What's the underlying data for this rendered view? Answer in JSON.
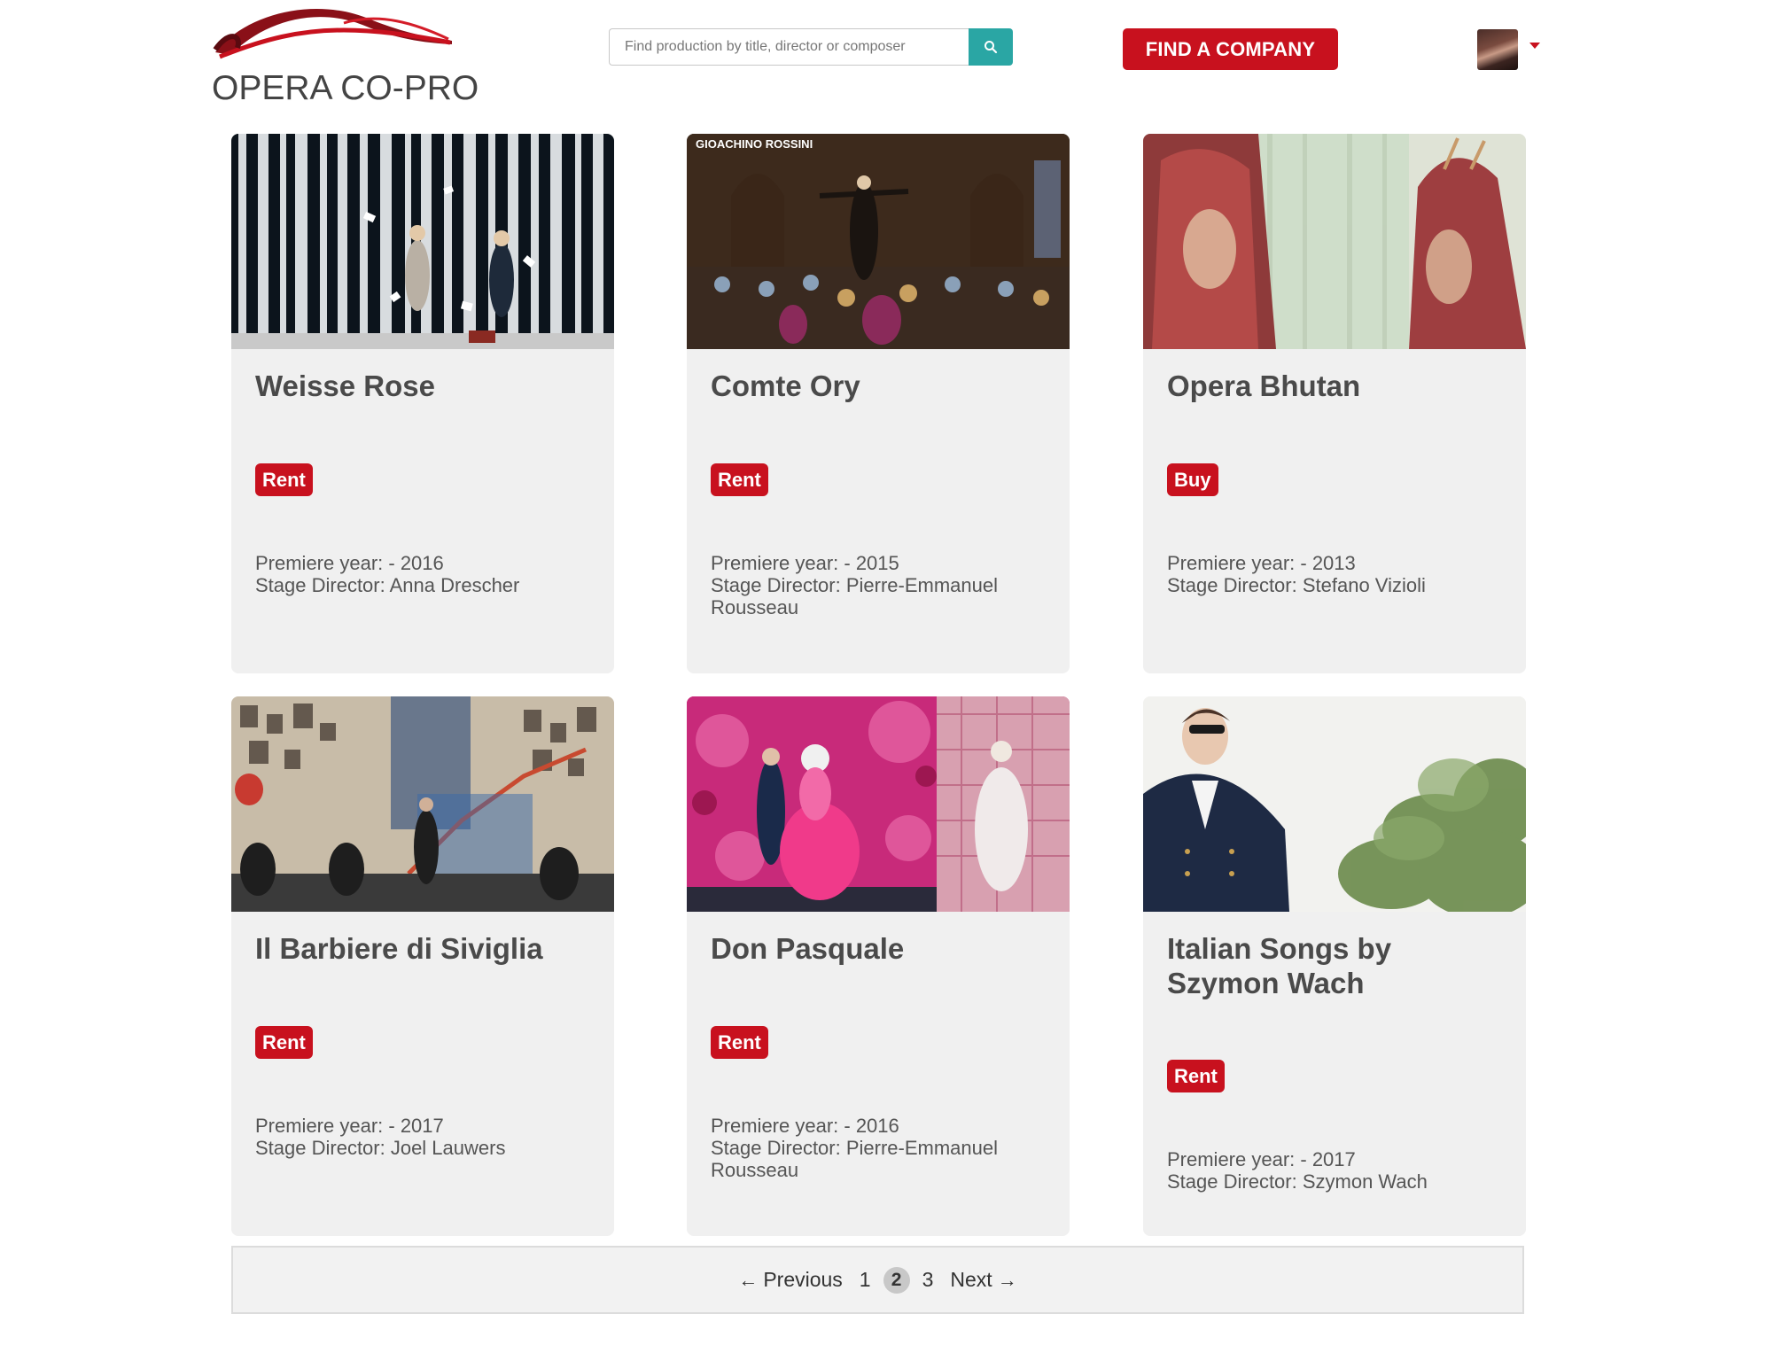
{
  "header": {
    "logo_text": "OPERA CO-PRO",
    "search_placeholder": "Find production by title, director or composer",
    "find_company_label": "FIND A COMPANY"
  },
  "colors": {
    "brand_red": "#c8111e",
    "search_teal": "#2aa6a4",
    "card_bg": "#f0f0f0"
  },
  "productions": [
    {
      "title": "Weisse Rose",
      "badge": "Rent",
      "premiere": "Premiere year: - 2016",
      "director_line1": "Stage Director: Anna Drescher",
      "director_line2": ""
    },
    {
      "title": "Comte Ory",
      "badge": "Rent",
      "image_caption": "GIOACHINO ROSSINI",
      "premiere": "Premiere year: - 2015",
      "director_line1": "Stage Director: Pierre-Emmanuel",
      "director_line2": "Rousseau"
    },
    {
      "title": "Opera Bhutan",
      "badge": "Buy",
      "premiere": "Premiere year: - 2013",
      "director_line1": "Stage Director: Stefano Vizioli",
      "director_line2": ""
    },
    {
      "title": "Il Barbiere di Siviglia",
      "badge": "Rent",
      "premiere": "Premiere year: - 2017",
      "director_line1": "Stage Director: Joel Lauwers",
      "director_line2": ""
    },
    {
      "title": "Don Pasquale",
      "badge": "Rent",
      "premiere": "Premiere year: - 2016",
      "director_line1": "Stage Director: Pierre-Emmanuel",
      "director_line2": "Rousseau"
    },
    {
      "title_line1": "Italian Songs by",
      "title_line2": "Szymon Wach",
      "badge": "Rent",
      "premiere": "Premiere year: - 2017",
      "director_line1": "Stage Director: Szymon Wach",
      "director_line2": ""
    }
  ],
  "pagination": {
    "previous_label": "Previous",
    "pages": [
      "1",
      "2",
      "3"
    ],
    "current_page": "2",
    "next_label": "Next"
  }
}
